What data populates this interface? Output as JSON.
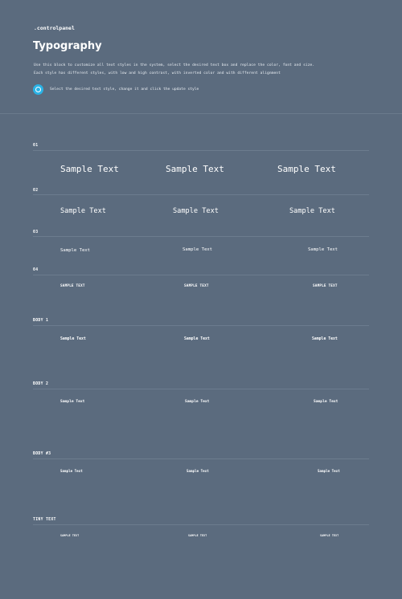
{
  "brand": ".controlpanel",
  "title": "Typography",
  "description": [
    "Use this block to customize all text styles in the system, select the desired text box and replace the color, font and size.",
    "Each style has different styles, with low and high contrast, with inverted color and with different alignment"
  ],
  "tip": {
    "icon": "settings-circle-icon",
    "text": "Select the desired text style, change it and click the update style"
  },
  "colors": {
    "background": "#5b6b7e",
    "accent": "#2ab3e6",
    "text": "#ffffff"
  },
  "rows": [
    {
      "label": "01",
      "samples": [
        "Sample Text",
        "Sample Text",
        "Sample Text"
      ]
    },
    {
      "label": "02",
      "samples": [
        "Sample Text",
        "Sample Text",
        "Sample Text"
      ]
    },
    {
      "label": "03",
      "samples": [
        "Sample Text",
        "Sample Text",
        "Sample Text"
      ]
    },
    {
      "label": "04",
      "samples": [
        "SAMPLE TEXT",
        "SAMPLE TEXT",
        "SAMPLE TEXT"
      ]
    },
    {
      "label": "BODY 1",
      "samples": [
        "Sample Text",
        "Sample Text",
        "Sample Text"
      ]
    },
    {
      "label": "BODY 2",
      "samples": [
        "Sample Text",
        "Sample Text",
        "Sample Text"
      ]
    },
    {
      "label": "BODY #3",
      "samples": [
        "Sample Text",
        "Sample Text",
        "Sample Text"
      ]
    },
    {
      "label": "TINY TEXT",
      "samples": [
        "SAMPLE TEXT",
        "SAMPLE TEXT",
        "SAMPLE TEXT"
      ]
    }
  ]
}
